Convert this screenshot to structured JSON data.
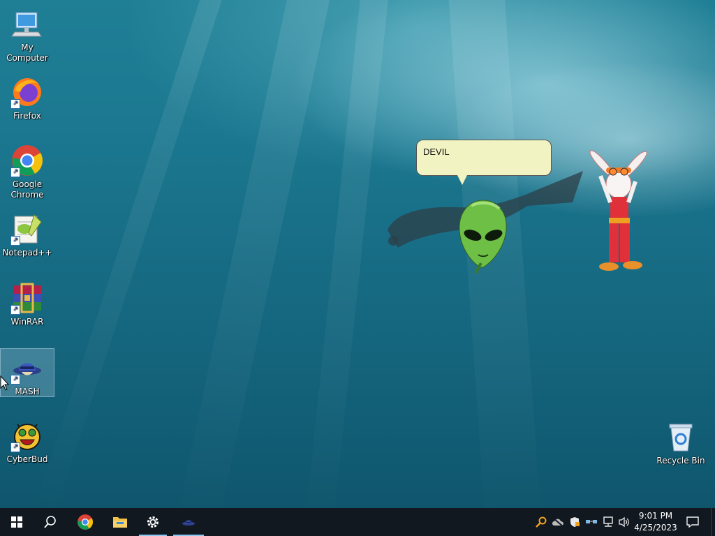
{
  "desktop": {
    "icons": [
      {
        "label": "My Computer",
        "icon": "computer-icon"
      },
      {
        "label": "Firefox",
        "icon": "firefox-icon"
      },
      {
        "label": "Google Chrome",
        "icon": "chrome-icon"
      },
      {
        "label": "Notepad++",
        "icon": "notepad-plus-plus-icon"
      },
      {
        "label": "WinRAR",
        "icon": "winrar-icon"
      },
      {
        "label": "MASH",
        "icon": "mash-icon"
      },
      {
        "label": "CyberBud",
        "icon": "cyberbud-icon"
      }
    ],
    "recycle_bin": {
      "label": "Recycle Bin",
      "icon": "recycle-bin-icon"
    }
  },
  "agent": {
    "speech": "DEVIL"
  },
  "taskbar": {
    "time": "9:01 PM",
    "date": "4/25/2023",
    "buttons": [
      "windows-start-icon",
      "search-icon",
      "chrome-icon",
      "file-explorer-icon",
      "settings-icon",
      "mash-icon"
    ]
  },
  "colors": {
    "taskbar": "#111820",
    "bubble": "#f1f3c3",
    "accent": "#8cc8f0"
  }
}
